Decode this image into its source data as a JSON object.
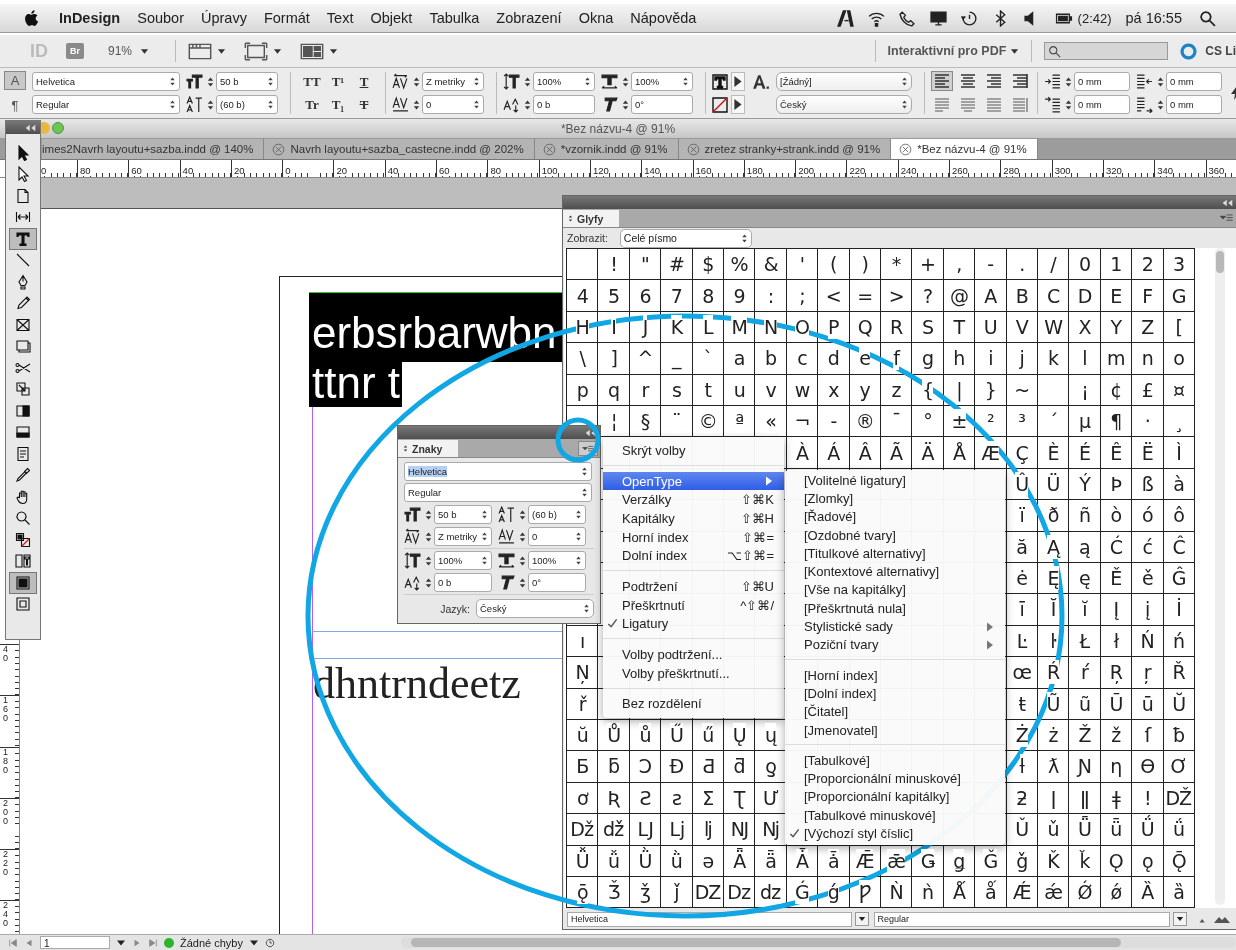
{
  "menubar": {
    "app_name": "InDesign",
    "items": [
      "Soubor",
      "Úpravy",
      "Formát",
      "Text",
      "Objekt",
      "Tabulka",
      "Zobrazení",
      "Okna",
      "Nápověda"
    ],
    "battery_time": "(2:42)",
    "clock": "pá 16:55"
  },
  "app_bar": {
    "logo": "ID",
    "bridge": "Br",
    "zoom": "91%",
    "workspace": "Interaktivní pro PDF",
    "cs_live": "CS Li"
  },
  "control_panel": {
    "mode_buttons": [
      {
        "label": "A",
        "selected": true
      },
      {
        "label": "¶",
        "selected": false
      }
    ],
    "font": "Helvetica",
    "style": "Regular",
    "size": "50 b",
    "leading": "(60 b)",
    "format_buttons": [
      {
        "label": "TT",
        "kind": "plain"
      },
      {
        "label": "T¹",
        "kind": "plain"
      },
      {
        "label": "T",
        "kind": "underline"
      },
      {
        "label": "Tr",
        "kind": "plain"
      },
      {
        "label": "T₁",
        "kind": "plain"
      },
      {
        "label": "T",
        "kind": "strike"
      }
    ],
    "tracking": "Z metriky",
    "kerning": "0",
    "vertical_scale": "100%",
    "baseline_shift": "0 b",
    "horizontal_scale": "100%",
    "skew": "0°",
    "char_style": "[Žádný]",
    "language": "Český",
    "align_buttons": [
      {
        "selected": true
      },
      {
        "selected": false
      },
      {
        "selected": false
      },
      {
        "selected": false
      },
      {
        "selected": false
      },
      {
        "selected": false
      },
      {
        "selected": false
      },
      {
        "selected": false
      }
    ],
    "left_indent": "0 mm",
    "first_line_indent": "0 mm",
    "right_indent": "0 mm",
    "last_line_indent": "0 mm"
  },
  "document": {
    "window_title": "*Bez názvu-4 @ 91%",
    "tabs": [
      {
        "label": "imes2Navrh layoutu+sazba.indd @ 140%",
        "selected": false,
        "closable": false
      },
      {
        "label": "Navrh layoutu+sazba_castecne.indd @ 202%",
        "selected": false,
        "closable": true
      },
      {
        "label": "*vzornik.indd @ 91%",
        "selected": false,
        "closable": true
      },
      {
        "label": "zretez stranky+strank.indd @ 91%",
        "selected": false,
        "closable": true
      },
      {
        "label": "*Bez názvu-4 @ 91%",
        "selected": true,
        "closable": true
      }
    ],
    "ruler_labels": [
      "0",
      "80",
      "60",
      "40",
      "20",
      "0",
      "20",
      "40",
      "60",
      "80",
      "100",
      "120",
      "140",
      "160",
      "180",
      "200",
      "220",
      "240",
      "260",
      "280",
      "300",
      "320",
      "340",
      "360"
    ],
    "vertical_ruler_labels": [
      "40",
      "160",
      "180",
      "200",
      "220",
      "240"
    ],
    "selected_text_lines": [
      "erbsrbarwbn",
      "ttnr t"
    ],
    "body_text": "dhntrndeetz"
  },
  "tools": [
    {
      "kind": "selection",
      "selected": false
    },
    {
      "kind": "direct",
      "selected": false
    },
    {
      "kind": "page",
      "selected": false
    },
    {
      "kind": "gap",
      "selected": false
    },
    {
      "kind": "type",
      "selected": true
    },
    {
      "kind": "line",
      "selected": false
    },
    {
      "kind": "pen",
      "selected": false
    },
    {
      "kind": "pencil",
      "selected": false
    },
    {
      "kind": "frame",
      "selected": false
    },
    {
      "kind": "rect",
      "selected": false
    },
    {
      "kind": "scissors",
      "selected": false
    },
    {
      "kind": "transform",
      "selected": false
    },
    {
      "kind": "gradient",
      "selected": false
    },
    {
      "kind": "feather",
      "selected": false
    },
    {
      "kind": "note",
      "selected": false
    },
    {
      "kind": "eyedropper",
      "selected": false
    },
    {
      "kind": "hand",
      "selected": false
    },
    {
      "kind": "zoom",
      "selected": false
    },
    {
      "kind": "fillstroke",
      "selected": false
    },
    {
      "kind": "formatting",
      "selected": false
    },
    {
      "kind": "normal_mode",
      "selected": true
    },
    {
      "kind": "preview_mode",
      "selected": false
    }
  ],
  "character_panel": {
    "tab": "Znaky",
    "font": "Helvetica",
    "style": "Regular",
    "size": "50 b",
    "leading": "(60 b)",
    "tracking": "Z metriky",
    "kerning": "0",
    "vertical_scale": "100%",
    "horizontal_scale": "100%",
    "baseline_shift": "0 b",
    "skew": "0°",
    "language_label": "Jazyk:",
    "language": "Český"
  },
  "panel_menu": {
    "items": [
      {
        "kind": "item",
        "label": "Skrýt volby",
        "checked": false,
        "selected": false,
        "submenu": false
      },
      {
        "kind": "separator"
      },
      {
        "kind": "item",
        "label": "OpenType",
        "checked": false,
        "selected": true,
        "submenu": true
      },
      {
        "kind": "item",
        "label": "Verzálky",
        "shortcut": "⇧⌘K",
        "checked": false,
        "selected": false,
        "submenu": false
      },
      {
        "kind": "item",
        "label": "Kapitálky",
        "shortcut": "⇧⌘H",
        "checked": false,
        "selected": false,
        "submenu": false
      },
      {
        "kind": "item",
        "label": "Horní index",
        "shortcut": "⇧⌘=",
        "checked": false,
        "selected": false,
        "submenu": false
      },
      {
        "kind": "item",
        "label": "Dolní index",
        "shortcut": "⌥⇧⌘=",
        "checked": false,
        "selected": false,
        "submenu": false
      },
      {
        "kind": "separator"
      },
      {
        "kind": "item",
        "label": "Podtržení",
        "shortcut": "⇧⌘U",
        "checked": false,
        "selected": false,
        "submenu": false
      },
      {
        "kind": "item",
        "label": "Přeškrtnutí",
        "shortcut": "^⇧⌘/",
        "checked": false,
        "selected": false,
        "submenu": false
      },
      {
        "kind": "item",
        "label": "Ligatury",
        "checked": true,
        "selected": false,
        "submenu": false
      },
      {
        "kind": "separator"
      },
      {
        "kind": "item",
        "label": "Volby podtržení...",
        "checked": false,
        "selected": false,
        "submenu": false
      },
      {
        "kind": "item",
        "label": "Volby přeškrtnutí...",
        "checked": false,
        "selected": false,
        "submenu": false
      },
      {
        "kind": "separator"
      },
      {
        "kind": "item",
        "label": "Bez rozdělení",
        "checked": false,
        "selected": false,
        "submenu": false
      }
    ]
  },
  "opentype_submenu": {
    "items": [
      {
        "kind": "item",
        "label": "[Volitelné ligatury]",
        "checked": false,
        "submenu": false
      },
      {
        "kind": "item",
        "label": "[Zlomky]",
        "checked": false,
        "submenu": false
      },
      {
        "kind": "item",
        "label": "[Řadové]",
        "checked": false,
        "submenu": false
      },
      {
        "kind": "item",
        "label": "[Ozdobné tvary]",
        "checked": false,
        "submenu": false
      },
      {
        "kind": "item",
        "label": "[Titulkové alternativy]",
        "checked": false,
        "submenu": false
      },
      {
        "kind": "item",
        "label": "[Kontextové alternativy]",
        "checked": false,
        "submenu": false
      },
      {
        "kind": "item",
        "label": "[Vše na kapitálky]",
        "checked": false,
        "submenu": false
      },
      {
        "kind": "item",
        "label": "[Přeškrtnutá nula]",
        "checked": false,
        "submenu": false
      },
      {
        "kind": "item",
        "label": "Stylistické sady",
        "checked": false,
        "submenu": true
      },
      {
        "kind": "item",
        "label": "Poziční tvary",
        "checked": false,
        "submenu": true
      },
      {
        "kind": "separator"
      },
      {
        "kind": "item",
        "label": "[Horní index]",
        "checked": false,
        "submenu": false
      },
      {
        "kind": "item",
        "label": "[Dolní index]",
        "checked": false,
        "submenu": false
      },
      {
        "kind": "item",
        "label": "[Čitatel]",
        "checked": false,
        "submenu": false
      },
      {
        "kind": "item",
        "label": "[Jmenovatel]",
        "checked": false,
        "submenu": false
      },
      {
        "kind": "separator"
      },
      {
        "kind": "item",
        "label": "[Tabulkové]",
        "checked": false,
        "submenu": false
      },
      {
        "kind": "item",
        "label": "[Proporcionální minuskové]",
        "checked": false,
        "submenu": false
      },
      {
        "kind": "item",
        "label": "[Proporcionální kapitálky]",
        "checked": false,
        "submenu": false
      },
      {
        "kind": "item",
        "label": "[Tabulkové minuskové]",
        "checked": false,
        "submenu": false
      },
      {
        "kind": "item",
        "label": "[Výchozí styl číslic]",
        "checked": true,
        "submenu": false
      }
    ]
  },
  "glyphs_panel": {
    "tab": "Glyfy",
    "show_label": "Zobrazit:",
    "show_value": "Celé písmo",
    "font": "Helvetica",
    "style": "Regular",
    "rows": [
      [
        null,
        "!",
        "\"",
        "#",
        "$",
        "%",
        "&",
        "'",
        "(",
        ")",
        "*",
        "+",
        ",",
        "-",
        ".",
        "/",
        "0",
        "1",
        "2",
        "3"
      ],
      [
        "4",
        "5",
        "6",
        "7",
        "8",
        "9",
        ":",
        ";",
        "<",
        "=",
        ">",
        "?",
        "@",
        "A",
        "B",
        "C",
        "D",
        "E",
        "F",
        "G"
      ],
      [
        "H",
        "I",
        "J",
        "K",
        "L",
        "M",
        "N",
        "O",
        "P",
        "Q",
        "R",
        "S",
        "T",
        "U",
        "V",
        "W",
        "X",
        "Y",
        "Z",
        "["
      ],
      [
        "\\",
        "]",
        "^",
        "_",
        "`",
        "a",
        "b",
        "c",
        "d",
        "e",
        "f",
        "g",
        "h",
        "i",
        "j",
        "k",
        "l",
        "m",
        "n",
        "o"
      ],
      [
        "p",
        "q",
        "r",
        "s",
        "t",
        "u",
        "v",
        "w",
        "x",
        "y",
        "z",
        "{",
        "|",
        "}",
        "~",
        null,
        "¡",
        "¢",
        "£",
        "¤"
      ],
      [
        null,
        "¦",
        "§",
        "¨",
        "©",
        "ª",
        "«",
        "¬",
        "-",
        "®",
        "¯",
        "°",
        "±",
        "²",
        "³",
        "´",
        "µ",
        "¶",
        "·",
        "¸"
      ],
      [
        null,
        null,
        null,
        null,
        null,
        null,
        null,
        "À",
        "Á",
        "Â",
        "Ã",
        "Ä",
        "Å",
        "Æ",
        "Ç",
        "È",
        "É",
        "Ê",
        "Ë",
        "Ì"
      ],
      [
        null,
        null,
        null,
        null,
        null,
        null,
        null,
        null,
        null,
        null,
        null,
        null,
        null,
        null,
        "Û",
        "Ü",
        "Ý",
        "Þ",
        "ß",
        "à"
      ],
      [
        null,
        null,
        null,
        null,
        null,
        null,
        null,
        null,
        null,
        null,
        null,
        null,
        null,
        null,
        "ï",
        "ð",
        "ñ",
        "ò",
        "ó",
        "ô"
      ],
      [
        null,
        null,
        null,
        null,
        null,
        null,
        null,
        null,
        null,
        null,
        null,
        null,
        null,
        null,
        "ă",
        "Ą",
        "ą",
        "Ć",
        "ć",
        "Ĉ"
      ],
      [
        null,
        null,
        null,
        null,
        null,
        null,
        null,
        null,
        null,
        null,
        null,
        null,
        null,
        null,
        "ė",
        "Ę",
        "ę",
        "Ě",
        "ě",
        "Ĝ"
      ],
      [
        null,
        null,
        null,
        null,
        null,
        null,
        null,
        null,
        null,
        null,
        null,
        null,
        null,
        null,
        "ī",
        "Ĭ",
        "ĭ",
        "Į",
        "į",
        "İ"
      ],
      [
        "ı",
        null,
        null,
        null,
        null,
        null,
        null,
        null,
        null,
        null,
        null,
        null,
        null,
        null,
        "Ŀ",
        "ŀ",
        "Ł",
        "ł",
        "Ń",
        "ń"
      ],
      [
        "Ņ",
        null,
        null,
        null,
        null,
        null,
        null,
        null,
        null,
        null,
        null,
        null,
        null,
        null,
        "œ",
        "Ŕ",
        "ŕ",
        "Ŗ",
        "ŗ",
        "Ř"
      ],
      [
        "ř",
        null,
        null,
        null,
        null,
        null,
        null,
        null,
        null,
        null,
        null,
        null,
        null,
        null,
        "ŧ",
        "Ũ",
        "ũ",
        "Ū",
        "ū",
        "Ŭ"
      ],
      [
        "ŭ",
        "Ů",
        "ů",
        "Ű",
        "ű",
        "Ų",
        "ų",
        null,
        null,
        null,
        null,
        null,
        null,
        null,
        "Ż",
        "ż",
        "Ž",
        "ž",
        "ſ",
        "ƀ"
      ],
      [
        "Ƃ",
        "ƃ",
        "Ɔ",
        "Đ",
        "Ƌ",
        "ƌ",
        "ƍ",
        null,
        null,
        null,
        null,
        null,
        null,
        null,
        "ƚ",
        "ƛ",
        "Ɲ",
        "ƞ",
        "Ɵ",
        "Ơ"
      ],
      [
        "ơ",
        "Ʀ",
        "Ƨ",
        "ƨ",
        "Ʃ",
        "Ʈ",
        "Ư",
        null,
        null,
        null,
        null,
        null,
        null,
        null,
        "ƻ",
        "ǀ",
        "ǁ",
        "ǂ",
        "ǃ",
        "Ǆ"
      ],
      [
        "ǅ",
        "ǆ",
        "Ǉ",
        "ǈ",
        "ǉ",
        "Ǌ",
        "ǋ",
        null,
        null,
        null,
        null,
        null,
        null,
        null,
        "Ǔ",
        "ǔ",
        "Ǖ",
        "ǖ",
        "Ǘ",
        "ǘ"
      ],
      [
        "Ǚ",
        "ǚ",
        "Ǜ",
        "ǜ",
        "ǝ",
        "Ǟ",
        "ǟ",
        "Ǡ",
        "ǡ",
        "Ǣ",
        "ǣ",
        "Ǥ",
        "ǥ",
        "Ǧ",
        "ǧ",
        "Ǩ",
        "ǩ",
        "Ǫ",
        "ǫ",
        "Ǭ"
      ],
      [
        "ǭ",
        "Ǯ",
        "ǯ",
        "ǰ",
        "Ǳ",
        "ǲ",
        "ǳ",
        "Ǵ",
        "ǵ",
        "Ƿ",
        "Ǹ",
        "ǹ",
        "Ǻ",
        "ǻ",
        "Ǽ",
        "ǽ",
        "Ǿ",
        "ǿ",
        "Ȁ",
        "ȁ"
      ]
    ]
  },
  "status_bar": {
    "page": "1",
    "preflight": "Žádné chyby",
    "preflight_ok": true
  }
}
